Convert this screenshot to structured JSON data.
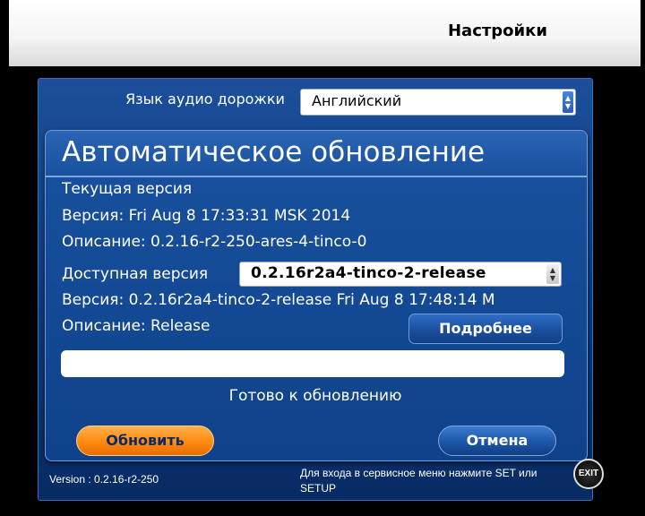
{
  "header": {
    "title": "Настройки"
  },
  "settings": {
    "audio_lang_label": "Язык аудио дорожки",
    "audio_lang_value": "Английский"
  },
  "dialog": {
    "title": "Автоматическое обновление",
    "current_heading": "Текущая версия",
    "current_version": "Версия: Fri Aug 8 17:33:31 MSK 2014",
    "current_description": "Описание: 0.2.16-r2-250-ares-4-tinco-0",
    "available_label": "Доступная версия",
    "available_select_value": "0.2.16r2a4-tinco-2-release",
    "available_version": "Версия: 0.2.16r2a4-tinco-2-release Fri Aug 8 17:48:14 M",
    "available_description": "Описание: Release",
    "details_button": "Подробнее",
    "progress_fraction": 0,
    "status": "Готово к обновлению",
    "update_button": "Обновить",
    "cancel_button": "Отмена"
  },
  "footer": {
    "version": "Version : 0.2.16-r2-250",
    "hint": "Для входа в сервисное меню нажмите SET или SETUP",
    "exit_label": "EXIT"
  },
  "colors": {
    "panel_blue": "#0d3a7e",
    "dialog_blue": "#174f9c",
    "accent_orange": "#ff8a10"
  }
}
